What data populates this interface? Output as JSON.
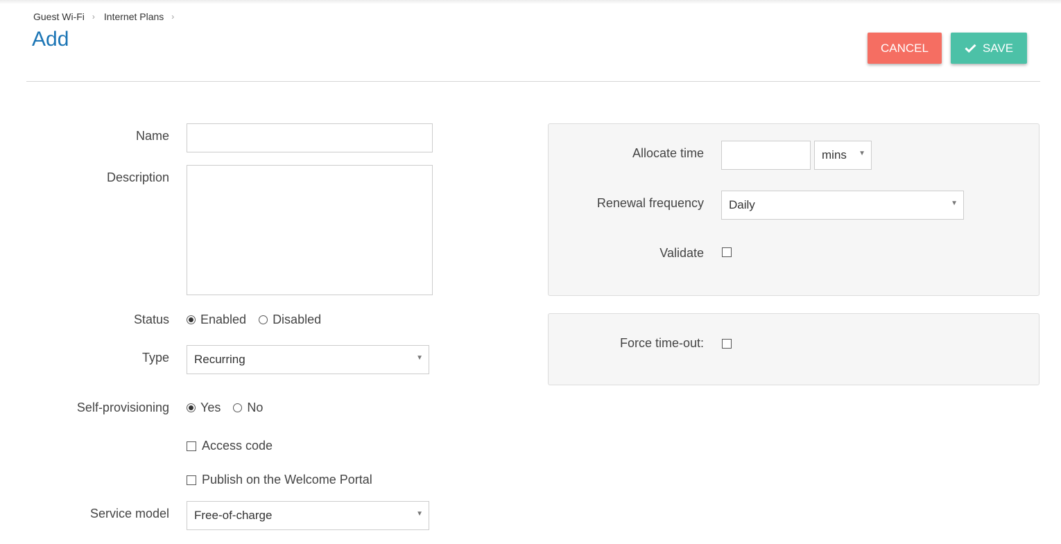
{
  "breadcrumb": [
    "Guest Wi-Fi",
    "Internet Plans"
  ],
  "page_title": "Add",
  "actions": {
    "cancel_label": "CANCEL",
    "save_label": "SAVE"
  },
  "form": {
    "name_label": "Name",
    "name_value": "",
    "description_label": "Description",
    "description_value": "",
    "status_label": "Status",
    "status_options": [
      "Enabled",
      "Disabled"
    ],
    "status_selected": "Enabled",
    "type_label": "Type",
    "type_value": "Recurring",
    "self_provisioning_label": "Self-provisioning",
    "self_provisioning_options": [
      "Yes",
      "No"
    ],
    "self_provisioning_selected": "Yes",
    "access_code_label": "Access code",
    "access_code_checked": false,
    "publish_label": "Publish on the Welcome Portal",
    "publish_checked": false,
    "service_model_label": "Service model",
    "service_model_value": "Free-of-charge"
  },
  "time_panel": {
    "allocate_time_label": "Allocate time",
    "allocate_time_value": "",
    "allocate_unit": "mins",
    "renewal_frequency_label": "Renewal frequency",
    "renewal_frequency_value": "Daily",
    "validate_label": "Validate",
    "validate_checked": false
  },
  "timeout_panel": {
    "force_timeout_label": "Force time-out:",
    "force_timeout_checked": false
  },
  "colors": {
    "title": "#1b75b5",
    "cancel": "#f56e62",
    "save": "#4cc1a7",
    "panel_bg": "#f6f6f6"
  },
  "icons": {
    "save": "check-icon",
    "breadcrumb_separator": "chevron-right-icon",
    "dropdown": "caret-down-icon"
  }
}
